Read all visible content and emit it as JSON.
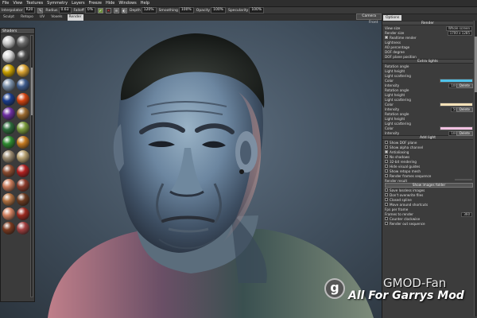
{
  "menubar": {
    "items": [
      "File",
      "View",
      "Textures",
      "Symmetry",
      "Layers",
      "Freeze",
      "Hide",
      "Windows",
      "Help"
    ]
  },
  "toolbar": {
    "interpolator_label": "Interpolator",
    "interpolator_value": "R20",
    "radius_label": "Radius",
    "radius_value": "0.63",
    "falloff_label": "Falloff",
    "falloff_value": "0%",
    "depth_label": "Depth",
    "depth_value": "120%",
    "smoothing_label": "Smoothing",
    "smoothing_value": "100%",
    "opacity_label": "Opacity",
    "opacity_value": "100%",
    "specularity_label": "Specularity",
    "specularity_value": "100%"
  },
  "mode_tabs": [
    "Sculpt",
    "Retopo",
    "UV",
    "Voxels",
    "Render"
  ],
  "active_mode": "Render",
  "view_tabs": {
    "camera": "Camera",
    "front": "Front"
  },
  "shaders_panel": {
    "title": "Shaders",
    "colors": [
      "#c9c9c9",
      "#6c6c6c",
      "#d8d8d8",
      "#4c4c4c",
      "#c8a000",
      "#d9a232",
      "#7a8fa8",
      "#3d5a8a",
      "#1a3c8a",
      "#d24310",
      "#6d2ea0",
      "#9a6a30",
      "#2c6a3a",
      "#7a9a3c",
      "#2e8a30",
      "#c47a20",
      "#9a8a70",
      "#b6a070",
      "#8a4a2e",
      "#b02020",
      "#c77a5a",
      "#8a3a2a",
      "#b07040",
      "#6a3a20",
      "#d08060",
      "#9a2a20",
      "#7a3a20",
      "#a04040"
    ]
  },
  "options_panel": {
    "title": "Options",
    "render_section": "Render",
    "view_size_label": "View size",
    "view_size_value": "Whole screen",
    "render_size_label": "Render size",
    "render_size_value": "1700 x 1285",
    "realtime_render": "Realtime render",
    "lightness": "Lightness",
    "ao_percentage": "AO percentage",
    "dof_degree": "DOF degree",
    "dof_plane": "DOF plane position",
    "extra_lights_section": "Extra lights",
    "lights": [
      {
        "rotation": "Rotation angle",
        "height": "Light height",
        "scattering": "Light scattering",
        "color_label": "Color",
        "color": "#4fc3ea",
        "intensity": "Intensity",
        "intensity_value": "100",
        "delete": "Delete"
      },
      {
        "rotation": "Rotation angle",
        "height": "Light height",
        "scattering": "Light scattering",
        "color_label": "Color",
        "color": "#f8e2b8",
        "intensity": "Intensity",
        "intensity_value": "50",
        "delete": "Delete"
      },
      {
        "rotation": "Rotation angle",
        "height": "Light height",
        "scattering": "Light scattering",
        "color_label": "Color",
        "color": "#f2c2e2",
        "intensity": "Intensity",
        "intensity_value": "100",
        "delete": "Delete"
      }
    ],
    "add_light": "Add light",
    "checks": [
      {
        "label": "Show DOF plane",
        "on": false
      },
      {
        "label": "Show alpha channel",
        "on": false
      },
      {
        "label": "Antialiasing",
        "on": true
      },
      {
        "label": "No shadows",
        "on": false
      },
      {
        "label": "32-bit rendering",
        "on": false
      },
      {
        "label": "Hide visual guides",
        "on": false
      },
      {
        "label": "Show retopo mesh",
        "on": false
      },
      {
        "label": "Render frames sequence",
        "on": false
      }
    ],
    "render_result": "Render result",
    "show_images_folder": "Show images folder",
    "checks2": [
      {
        "label": "Save lossless images",
        "on": false
      },
      {
        "label": "Don't overwrite files",
        "on": false
      },
      {
        "label": "Closed spline",
        "on": false
      },
      {
        "label": "Move around shortcuts",
        "on": false
      }
    ],
    "fps_label": "Fps per frame",
    "frames_label": "Frames to render",
    "frames_value": "360",
    "counter_clockwise": "Counter clockwise",
    "render_out_sequence": "Render out sequence"
  },
  "watermark": {
    "logo_glyph": "g",
    "site": "GMOD-Fan",
    "tagline": "All For Garrys Mod"
  }
}
